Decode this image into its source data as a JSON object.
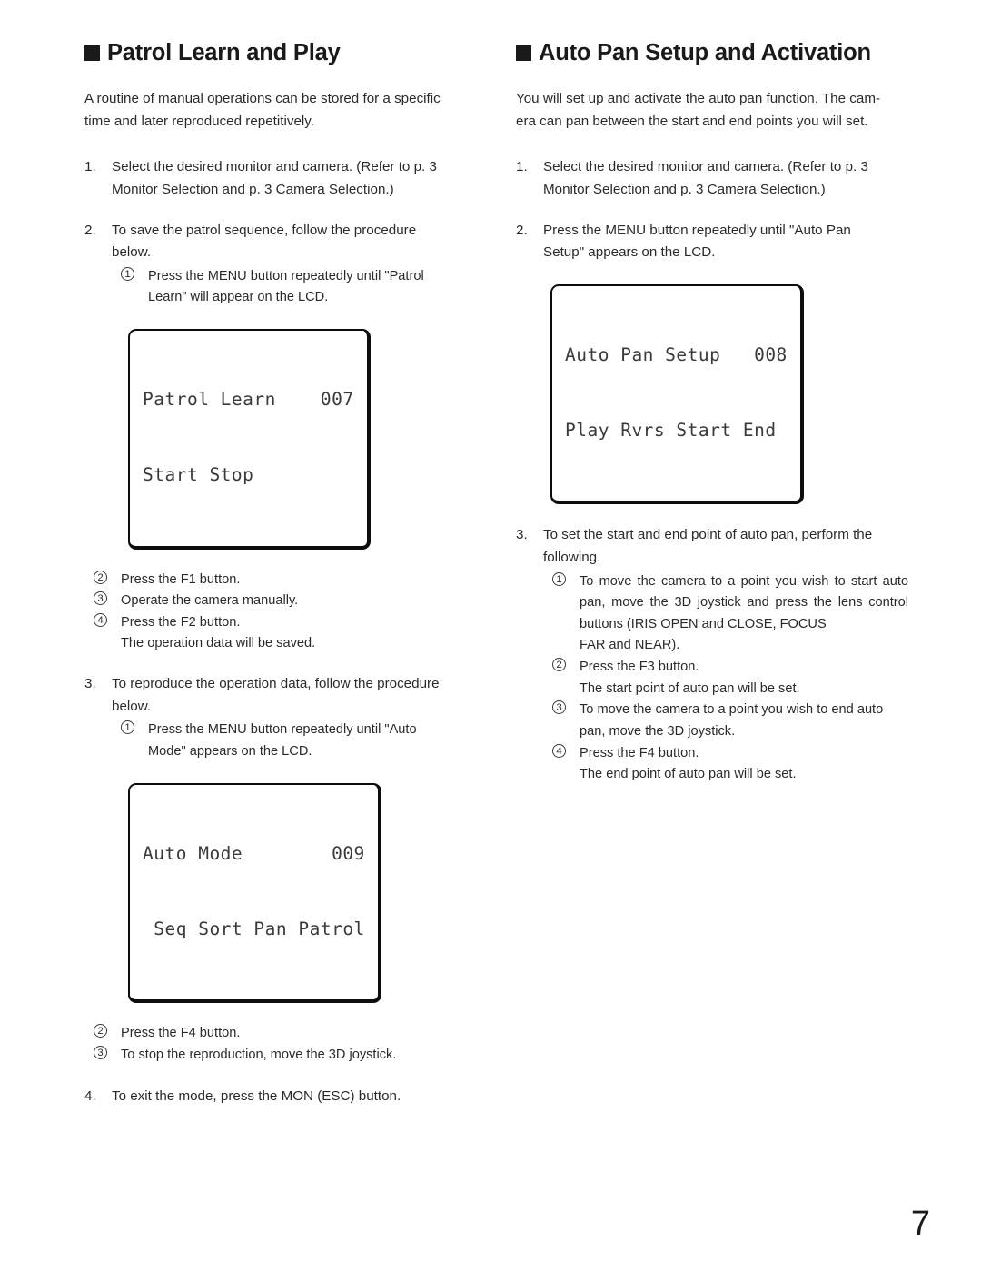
{
  "document": {
    "page_number": "7",
    "bullet_icon": "filled-square-bullet"
  },
  "left_column": {
    "heading": "Patrol Learn and Play",
    "intro_main": "A routine of manual operations can be stored for a specific",
    "intro_last": "time and later reproduced repetitively.",
    "steps": [
      {
        "number": "1.",
        "text_main": "Select the desired monitor and camera. (Refer to p. 3",
        "text_last": "Monitor Selection and p. 3 Camera Selection.)"
      },
      {
        "number": "2.",
        "text_main": "To save the patrol sequence, follow the procedure",
        "text_last": "below.",
        "substeps": [
          {
            "marker": "1",
            "text_main": "Press the MENU button repeatedly until \"Patrol",
            "text_last": "Learn\" will appear on the LCD."
          }
        ],
        "lcd": {
          "line1": "Patrol Learn    007",
          "line2": "Start Stop"
        },
        "substeps_after": [
          {
            "marker": "2",
            "text": "Press the F1 button."
          },
          {
            "marker": "3",
            "text": "Operate the camera manually."
          },
          {
            "marker": "4",
            "text": "Press the F2 button.",
            "continuation": "The operation data will be saved."
          }
        ]
      },
      {
        "number": "3.",
        "text_main": "To reproduce the operation data, follow the procedure",
        "text_last": "below.",
        "substeps": [
          {
            "marker": "1",
            "text_main": "Press the MENU button repeatedly until \"Auto",
            "text_last": "Mode\" appears on the LCD."
          }
        ],
        "lcd": {
          "line1": "Auto Mode        009",
          "line2": " Seq Sort Pan Patrol"
        },
        "substeps_after": [
          {
            "marker": "2",
            "text": "Press the F4 button."
          },
          {
            "marker": "3",
            "text": "To stop the reproduction, move the 3D joystick."
          }
        ]
      },
      {
        "number": "4.",
        "text_main": "To exit the mode, press the MON (ESC) button."
      }
    ]
  },
  "right_column": {
    "heading": "Auto Pan Setup and Activation",
    "intro_main": "You will set up and activate the auto pan function. The cam-",
    "intro_last": "era can pan between the start and end points you will set.",
    "steps": [
      {
        "number": "1.",
        "text_main": "Select the desired monitor and camera. (Refer to p. 3",
        "text_last": "Monitor Selection and p. 3 Camera Selection.)"
      },
      {
        "number": "2.",
        "text_main": "Press the MENU button repeatedly until \"Auto Pan",
        "text_last": "Setup\" appears on the LCD.",
        "lcd": {
          "line1": "Auto Pan Setup   008",
          "line2": "Play Rvrs Start End"
        }
      },
      {
        "number": "3.",
        "text_main": "To set the start and end point of auto pan, perform the",
        "text_last": "following.",
        "substeps": [
          {
            "marker": "1",
            "text_main": "To move the camera to a point you wish to start auto pan, move the 3D joystick and press the lens control buttons (IRIS OPEN and CLOSE, FOCUS",
            "text_last": "FAR and NEAR)."
          },
          {
            "marker": "2",
            "text_main": "Press the F3 button.",
            "continuation": "The start point of auto pan will be set."
          },
          {
            "marker": "3",
            "text_main": "To move the camera to a point you wish to end auto",
            "text_last": "pan, move the 3D joystick."
          },
          {
            "marker": "4",
            "text_main": "Press the F4 button.",
            "continuation": "The end point of auto pan will be set."
          }
        ]
      }
    ]
  }
}
